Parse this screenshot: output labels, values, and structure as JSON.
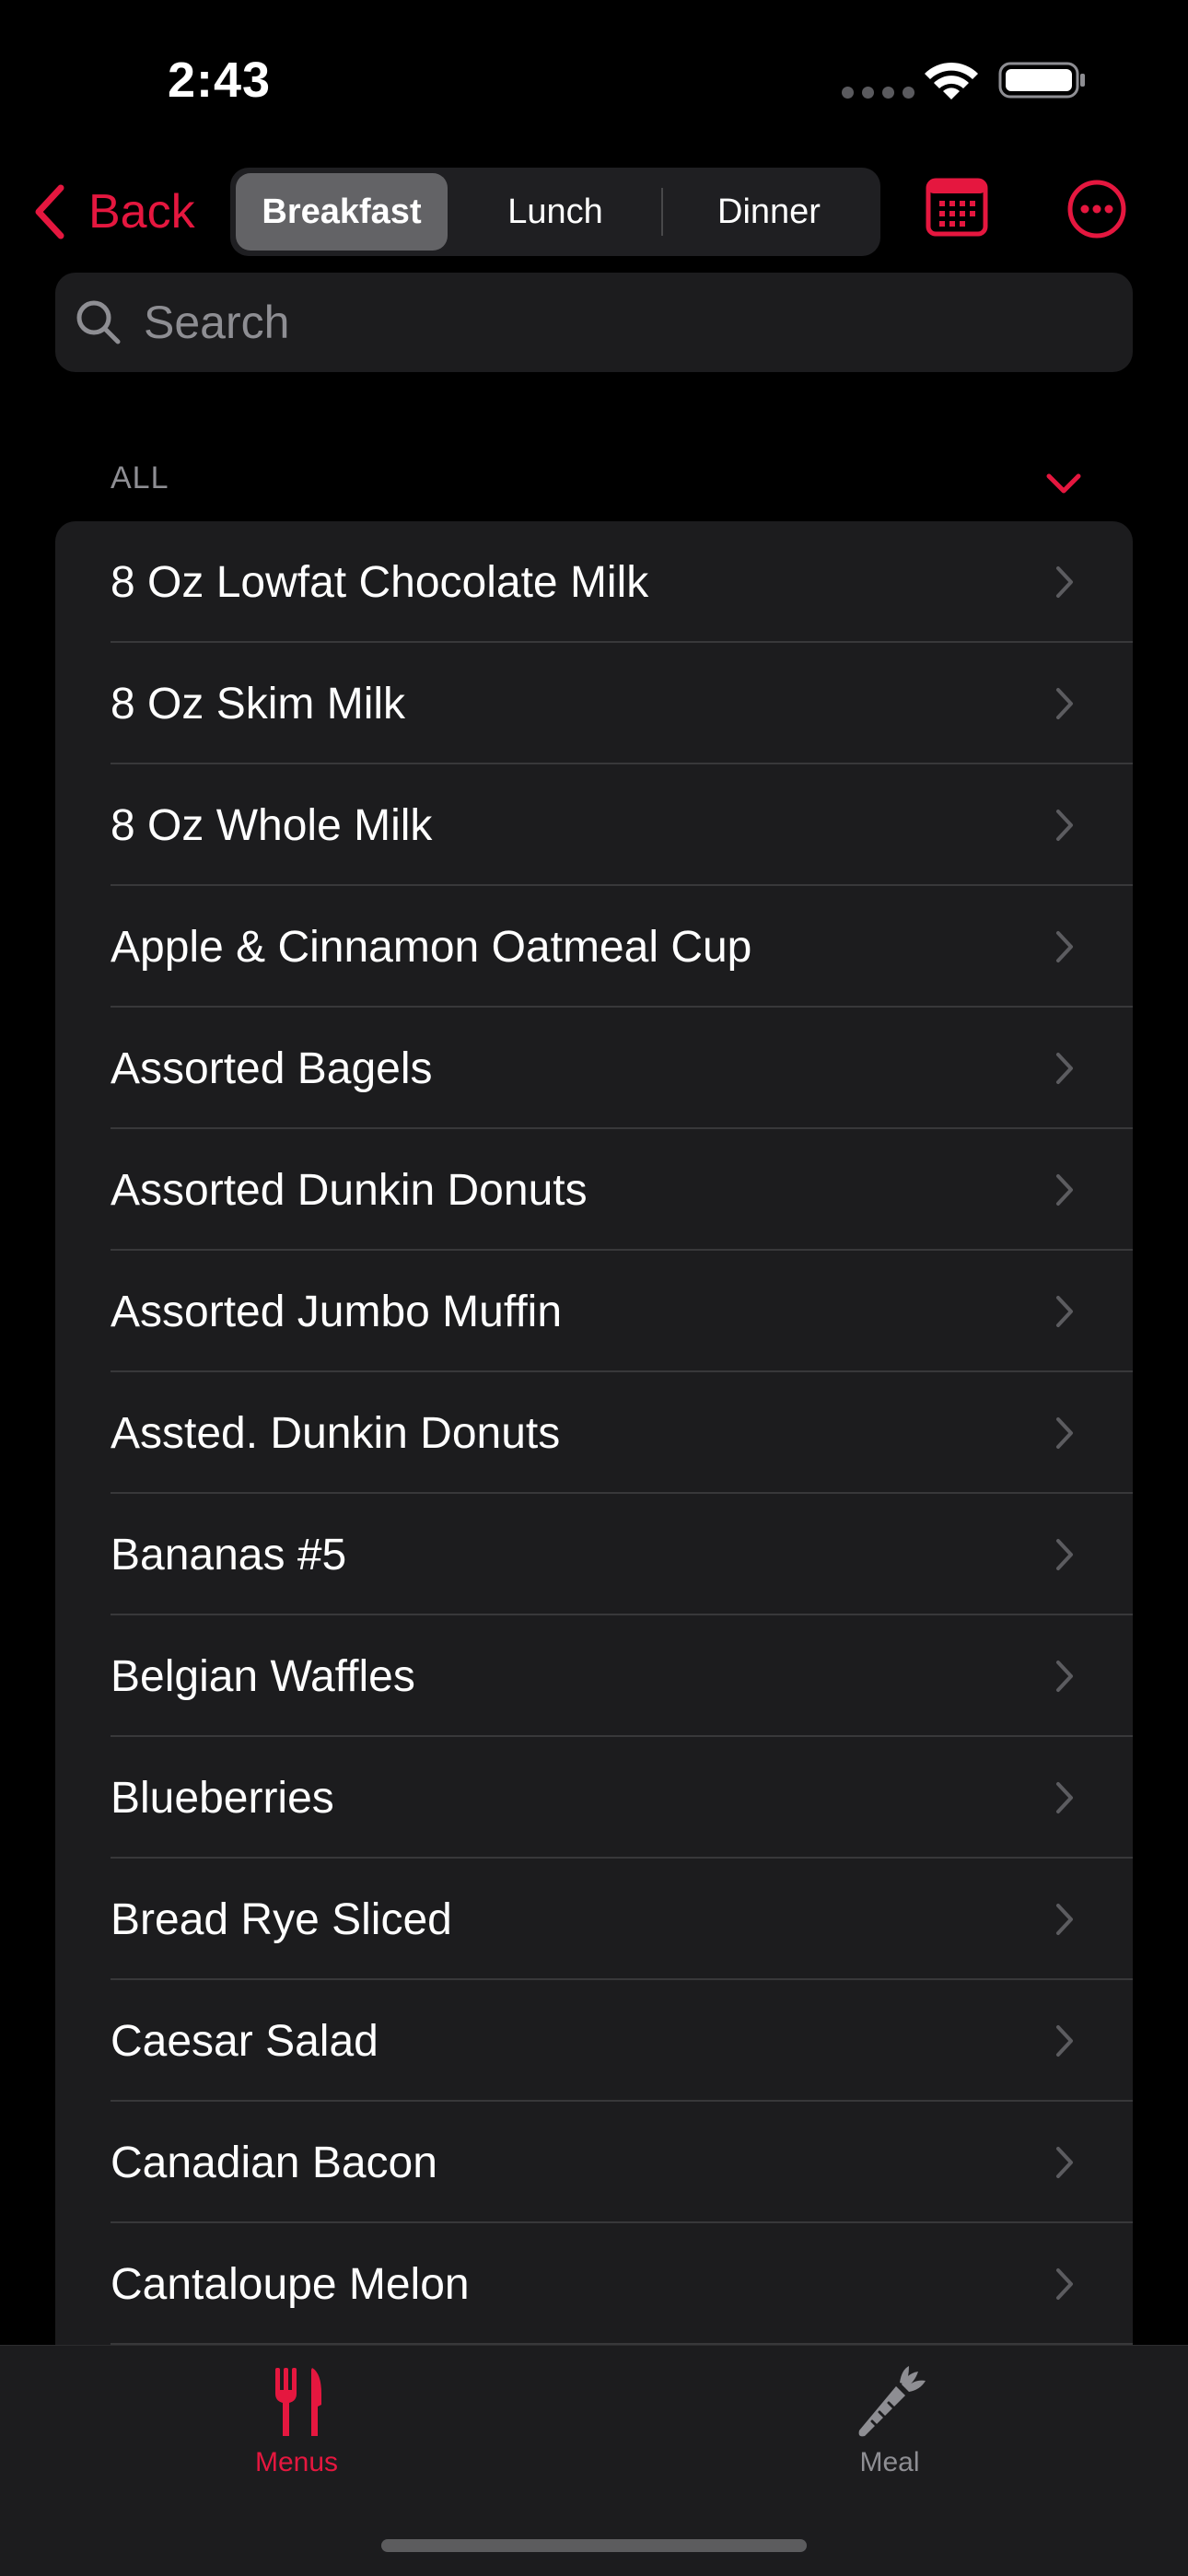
{
  "status_bar": {
    "time": "2:43"
  },
  "nav": {
    "back_label": "Back",
    "segments": [
      {
        "label": "Breakfast",
        "selected": true
      },
      {
        "label": "Lunch",
        "selected": false
      },
      {
        "label": "Dinner",
        "selected": false
      }
    ],
    "calendar_icon": "calendar-icon",
    "more_icon": "ellipsis-circle-icon"
  },
  "search": {
    "placeholder": "Search",
    "value": ""
  },
  "section": {
    "title": "ALL",
    "collapse_icon": "chevron-down-icon"
  },
  "items": [
    {
      "label": "8 Oz Lowfat Chocolate Milk"
    },
    {
      "label": "8 Oz Skim Milk"
    },
    {
      "label": "8 Oz Whole Milk"
    },
    {
      "label": "Apple & Cinnamon Oatmeal Cup"
    },
    {
      "label": "Assorted Bagels"
    },
    {
      "label": "Assorted Dunkin Donuts"
    },
    {
      "label": "Assorted Jumbo Muffin"
    },
    {
      "label": "Assted. Dunkin Donuts"
    },
    {
      "label": "Bananas #5"
    },
    {
      "label": "Belgian Waffles"
    },
    {
      "label": "Blueberries"
    },
    {
      "label": "Bread Rye Sliced"
    },
    {
      "label": "Caesar Salad"
    },
    {
      "label": "Canadian Bacon"
    },
    {
      "label": "Cantaloupe Melon"
    }
  ],
  "tabs": [
    {
      "label": "Menus",
      "icon": "fork-knife-icon",
      "selected": true
    },
    {
      "label": "Meal",
      "icon": "carrot-icon",
      "selected": false
    }
  ],
  "colors": {
    "accent": "#e5173f",
    "background": "#000000",
    "cell": "#1c1c1e",
    "secondary_text": "#8e8e93"
  }
}
